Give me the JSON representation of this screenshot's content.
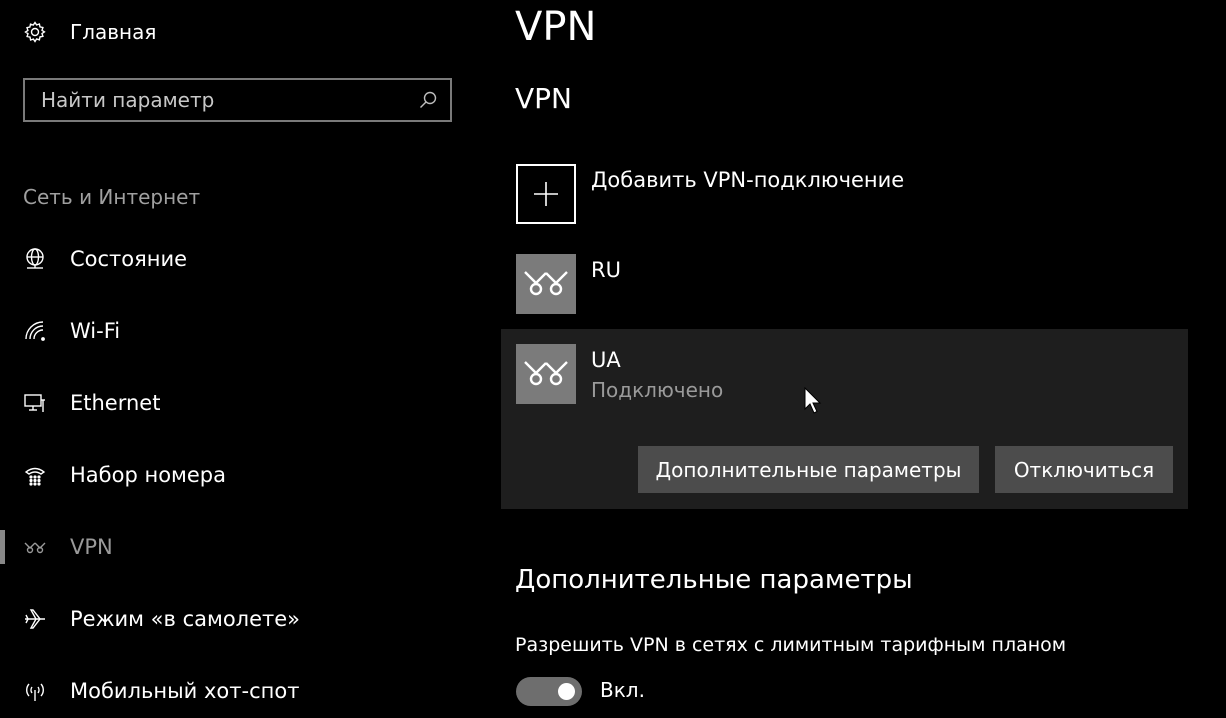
{
  "sidebar": {
    "home_label": "Главная",
    "search_placeholder": "Найти параметр",
    "section_label": "Сеть и Интернет",
    "items": [
      {
        "label": "Состояние",
        "icon": "globe-icon"
      },
      {
        "label": "Wi-Fi",
        "icon": "wifi-icon"
      },
      {
        "label": "Ethernet",
        "icon": "ethernet-icon"
      },
      {
        "label": "Набор номера",
        "icon": "dialup-icon"
      },
      {
        "label": "VPN",
        "icon": "vpn-icon",
        "active": true
      },
      {
        "label": "Режим «в самолете»",
        "icon": "airplane-icon"
      },
      {
        "label": "Мобильный хот-спот",
        "icon": "hotspot-icon"
      }
    ]
  },
  "main": {
    "page_title": "VPN",
    "section_title": "VPN",
    "add_connection_label": "Добавить VPN-подключение",
    "connections": [
      {
        "name": "RU",
        "status": ""
      },
      {
        "name": "UA",
        "status": "Подключено",
        "selected": true
      }
    ],
    "buttons": {
      "advanced": "Дополнительные параметры",
      "disconnect": "Отключиться"
    },
    "advanced_section": {
      "title": "Дополнительные параметры",
      "metered_label": "Разрешить VPN в сетях с лимитным тарифным планом",
      "metered_state": "Вкл."
    }
  },
  "colors": {
    "background": "#000000",
    "selected_panel": "#1e1e1e",
    "button": "#4c4c4c",
    "vpn_tile": "#7b7b7b"
  }
}
